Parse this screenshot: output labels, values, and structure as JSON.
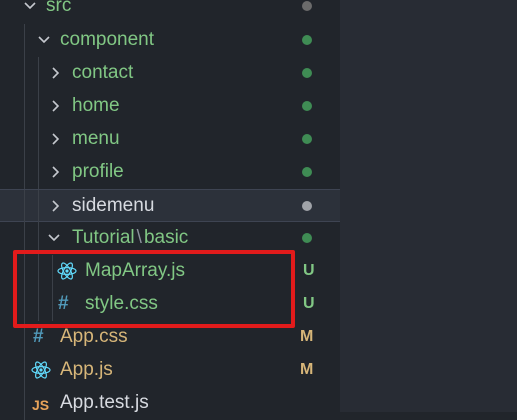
{
  "tree": {
    "src": {
      "label": "src",
      "status_color": "#6b6b6b"
    },
    "component": {
      "label": "component",
      "status_color": "#3f8c54"
    },
    "contact": {
      "label": "contact",
      "status_color": "#3f8c54"
    },
    "home": {
      "label": "home",
      "status_color": "#3f8c54"
    },
    "menu": {
      "label": "menu",
      "status_color": "#3f8c54"
    },
    "profile": {
      "label": "profile",
      "status_color": "#3f8c54"
    },
    "sidemenu": {
      "label": "sidemenu",
      "status_color": "#a0a3a8"
    },
    "tutorial": {
      "label": "Tutorial",
      "separator": "\\",
      "sub": "basic",
      "status_color": "#3f8c54"
    },
    "maparray": {
      "label": "MapArray.js",
      "badge": "U",
      "icon": "react-icon"
    },
    "stylecss": {
      "label": "style.css",
      "badge": "U",
      "icon": "css-hash-icon"
    },
    "appcss": {
      "label": "App.css",
      "badge": "M",
      "icon": "css-hash-icon"
    },
    "appjs": {
      "label": "App.js",
      "badge": "M",
      "icon": "react-icon"
    },
    "apptestjs": {
      "label": "App.test.js",
      "icon_text": "JS",
      "icon": "js-icon"
    }
  },
  "colors": {
    "untracked": "#81c784",
    "modified": "#d7b679",
    "highlight": "#e21b1b"
  }
}
